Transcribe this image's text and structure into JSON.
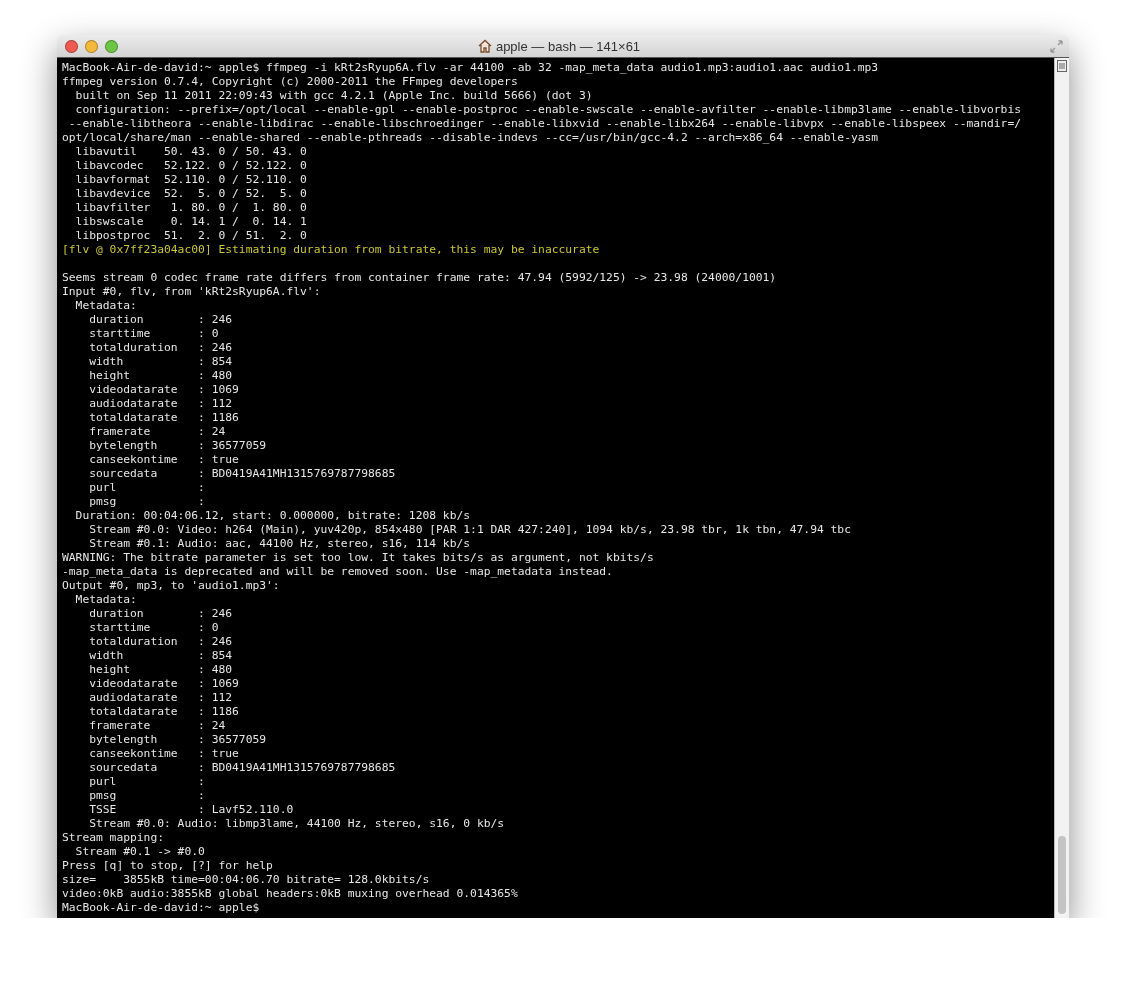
{
  "window": {
    "title": "apple — bash — 141×61"
  },
  "terminal": {
    "lines": [
      {
        "kind": "normal",
        "text": "MacBook-Air-de-david:~ apple$ ffmpeg -i kRt2sRyup6A.flv -ar 44100 -ab 32 -map_meta_data audio1.mp3:audio1.aac audio1.mp3"
      },
      {
        "kind": "normal",
        "text": "ffmpeg version 0.7.4, Copyright (c) 2000-2011 the FFmpeg developers"
      },
      {
        "kind": "normal",
        "text": "  built on Sep 11 2011 22:09:43 with gcc 4.2.1 (Apple Inc. build 5666) (dot 3)"
      },
      {
        "kind": "normal",
        "text": "  configuration: --prefix=/opt/local --enable-gpl --enable-postproc --enable-swscale --enable-avfilter --enable-libmp3lame --enable-libvorbis"
      },
      {
        "kind": "normal",
        "text": " --enable-libtheora --enable-libdirac --enable-libschroedinger --enable-libxvid --enable-libx264 --enable-libvpx --enable-libspeex --mandir=/"
      },
      {
        "kind": "normal",
        "text": "opt/local/share/man --enable-shared --enable-pthreads --disable-indevs --cc=/usr/bin/gcc-4.2 --arch=x86_64 --enable-yasm"
      },
      {
        "kind": "normal",
        "text": "  libavutil    50. 43. 0 / 50. 43. 0"
      },
      {
        "kind": "normal",
        "text": "  libavcodec   52.122. 0 / 52.122. 0"
      },
      {
        "kind": "normal",
        "text": "  libavformat  52.110. 0 / 52.110. 0"
      },
      {
        "kind": "normal",
        "text": "  libavdevice  52.  5. 0 / 52.  5. 0"
      },
      {
        "kind": "normal",
        "text": "  libavfilter   1. 80. 0 /  1. 80. 0"
      },
      {
        "kind": "normal",
        "text": "  libswscale    0. 14. 1 /  0. 14. 1"
      },
      {
        "kind": "normal",
        "text": "  libpostproc  51.  2. 0 / 51.  2. 0"
      },
      {
        "kind": "warning",
        "text": "[flv @ 0x7ff23a04ac00] Estimating duration from bitrate, this may be inaccurate"
      },
      {
        "kind": "normal",
        "space_before": true,
        "text": "Seems stream 0 codec frame rate differs from container frame rate: 47.94 (5992/125) -> 23.98 (24000/1001)"
      },
      {
        "kind": "normal",
        "text": "Input #0, flv, from 'kRt2sRyup6A.flv':"
      },
      {
        "kind": "normal",
        "text": "  Metadata:"
      },
      {
        "kind": "normal",
        "text": "    duration        : 246"
      },
      {
        "kind": "normal",
        "text": "    starttime       : 0"
      },
      {
        "kind": "normal",
        "text": "    totalduration   : 246"
      },
      {
        "kind": "normal",
        "text": "    width           : 854"
      },
      {
        "kind": "normal",
        "text": "    height          : 480"
      },
      {
        "kind": "normal",
        "text": "    videodatarate   : 1069"
      },
      {
        "kind": "normal",
        "text": "    audiodatarate   : 112"
      },
      {
        "kind": "normal",
        "text": "    totaldatarate   : 1186"
      },
      {
        "kind": "normal",
        "text": "    framerate       : 24"
      },
      {
        "kind": "normal",
        "text": "    bytelength      : 36577059"
      },
      {
        "kind": "normal",
        "text": "    canseekontime   : true"
      },
      {
        "kind": "normal",
        "text": "    sourcedata      : BD0419A41MH1315769787798685"
      },
      {
        "kind": "normal",
        "text": "    purl            :"
      },
      {
        "kind": "normal",
        "text": "    pmsg            :"
      },
      {
        "kind": "normal",
        "text": "  Duration: 00:04:06.12, start: 0.000000, bitrate: 1208 kb/s"
      },
      {
        "kind": "normal",
        "text": "    Stream #0.0: Video: h264 (Main), yuv420p, 854x480 [PAR 1:1 DAR 427:240], 1094 kb/s, 23.98 tbr, 1k tbn, 47.94 tbc"
      },
      {
        "kind": "normal",
        "text": "    Stream #0.1: Audio: aac, 44100 Hz, stereo, s16, 114 kb/s"
      },
      {
        "kind": "normal",
        "text": "WARNING: The bitrate parameter is set too low. It takes bits/s as argument, not kbits/s"
      },
      {
        "kind": "normal",
        "text": "-map_meta_data is deprecated and will be removed soon. Use -map_metadata instead."
      },
      {
        "kind": "normal",
        "text": "Output #0, mp3, to 'audio1.mp3':"
      },
      {
        "kind": "normal",
        "text": "  Metadata:"
      },
      {
        "kind": "normal",
        "text": "    duration        : 246"
      },
      {
        "kind": "normal",
        "text": "    starttime       : 0"
      },
      {
        "kind": "normal",
        "text": "    totalduration   : 246"
      },
      {
        "kind": "normal",
        "text": "    width           : 854"
      },
      {
        "kind": "normal",
        "text": "    height          : 480"
      },
      {
        "kind": "normal",
        "text": "    videodatarate   : 1069"
      },
      {
        "kind": "normal",
        "text": "    audiodatarate   : 112"
      },
      {
        "kind": "normal",
        "text": "    totaldatarate   : 1186"
      },
      {
        "kind": "normal",
        "text": "    framerate       : 24"
      },
      {
        "kind": "normal",
        "text": "    bytelength      : 36577059"
      },
      {
        "kind": "normal",
        "text": "    canseekontime   : true"
      },
      {
        "kind": "normal",
        "text": "    sourcedata      : BD0419A41MH1315769787798685"
      },
      {
        "kind": "normal",
        "text": "    purl            :"
      },
      {
        "kind": "normal",
        "text": "    pmsg            :"
      },
      {
        "kind": "normal",
        "text": "    TSSE            : Lavf52.110.0"
      },
      {
        "kind": "normal",
        "text": "    Stream #0.0: Audio: libmp3lame, 44100 Hz, stereo, s16, 0 kb/s"
      },
      {
        "kind": "normal",
        "text": "Stream mapping:"
      },
      {
        "kind": "normal",
        "text": "  Stream #0.1 -> #0.0"
      },
      {
        "kind": "normal",
        "text": "Press [q] to stop, [?] for help"
      },
      {
        "kind": "normal",
        "text": "size=    3855kB time=00:04:06.70 bitrate= 128.0kbits/s"
      },
      {
        "kind": "normal",
        "text": "video:0kB audio:3855kB global headers:0kB muxing overhead 0.014365%"
      },
      {
        "kind": "normal",
        "text": "MacBook-Air-de-david:~ apple$"
      }
    ]
  }
}
